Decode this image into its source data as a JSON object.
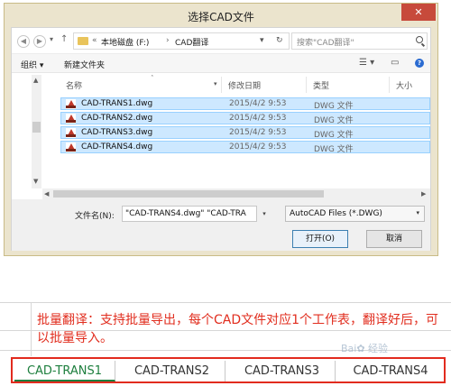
{
  "dialog": {
    "title": "选择CAD文件",
    "close_glyph": "✕",
    "nav": {
      "back": "◀",
      "forward": "▶",
      "dropdown": "▾",
      "up": "↑"
    },
    "address": {
      "prefix": "«",
      "drive": "本地磁盘 (F:)",
      "sep": "›",
      "folder": "CAD翻译",
      "drop": "▾",
      "refresh": "↻"
    },
    "search_placeholder": "搜索\"CAD翻译\"",
    "toolbar": {
      "organize": "组织 ▾",
      "new_folder": "新建文件夹",
      "view_glyph": "☰ ▾",
      "pane_glyph": "▭",
      "help": "?"
    },
    "columns": {
      "name": "名称",
      "date": "修改日期",
      "type": "类型",
      "size": "大小"
    },
    "files": [
      {
        "name": "CAD-TRANS1.dwg",
        "date": "2015/4/2 9:53",
        "type": "DWG 文件"
      },
      {
        "name": "CAD-TRANS2.dwg",
        "date": "2015/4/2 9:53",
        "type": "DWG 文件"
      },
      {
        "name": "CAD-TRANS3.dwg",
        "date": "2015/4/2 9:53",
        "type": "DWG 文件"
      },
      {
        "name": "CAD-TRANS4.dwg",
        "date": "2015/4/2 9:53",
        "type": "DWG 文件"
      }
    ],
    "filename_label": "文件名(N):",
    "filename_value": "\"CAD-TRANS4.dwg\" \"CAD-TRA",
    "filetype": "AutoCAD Files (*.DWG)",
    "open_button": "打开(O)",
    "cancel_button": "取消"
  },
  "caption": "批量翻译：支持批量导出，每个CAD文件对应1个工作表，翻译好后，可以批量导入。",
  "sheet_tabs": [
    "CAD-TRANS1",
    "CAD-TRANS2",
    "CAD-TRANS3",
    "CAD-TRANS4"
  ],
  "watermark": "Bai✿ 经验",
  "colors": {
    "accent_red": "#e12d1e",
    "selected_row": "#cde8ff",
    "active_tab": "#1e7f3e"
  }
}
